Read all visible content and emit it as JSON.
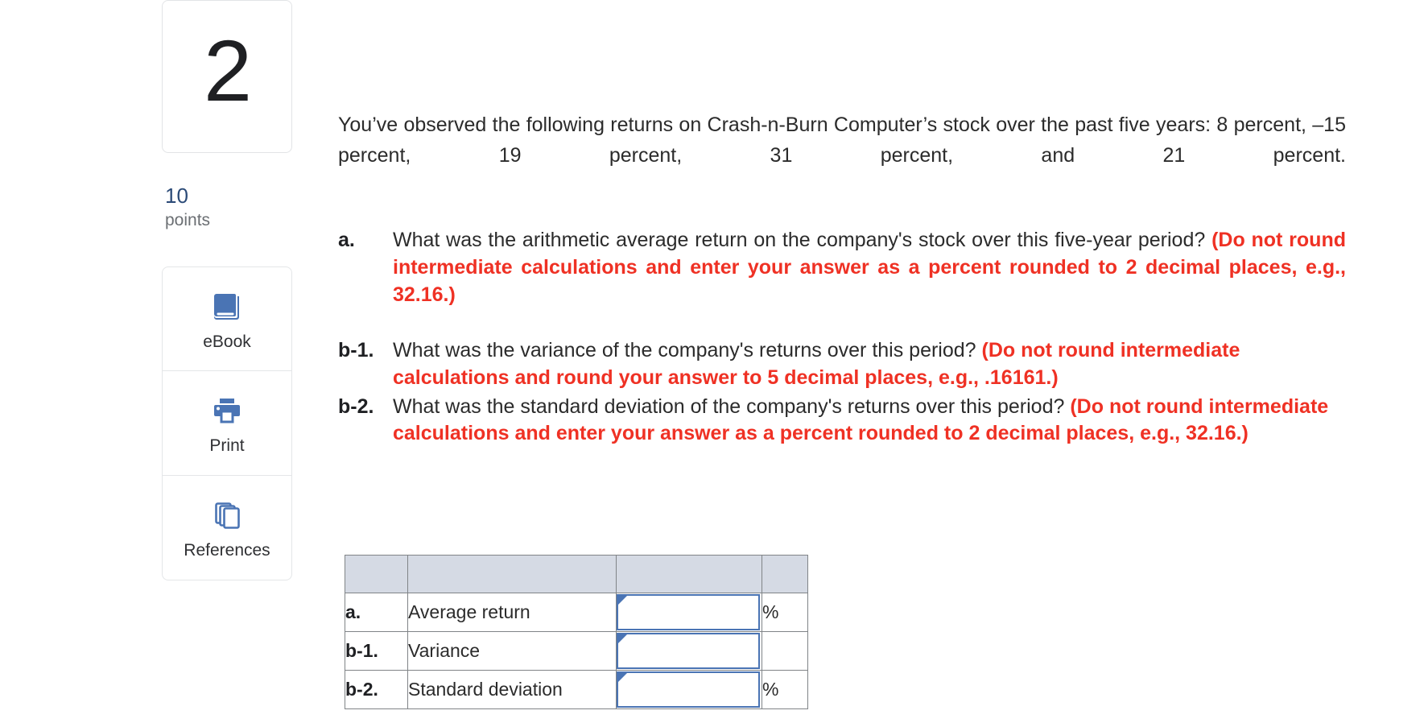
{
  "question": {
    "number": "2",
    "points_value": "10",
    "points_label": "points",
    "intro": "You’ve observed the following returns on Crash-n-Burn Computer’s stock over the past five years: 8 percent, –15 percent, 19 percent, 31 percent, and 21 percent."
  },
  "tools": [
    {
      "label": "eBook",
      "icon": "book-icon"
    },
    {
      "label": "Print",
      "icon": "printer-icon"
    },
    {
      "label": "References",
      "icon": "pages-stack-icon"
    }
  ],
  "parts": [
    {
      "letter": "a.",
      "text": "What was the arithmetic average return on the company's stock over this five-year period? ",
      "hint": "(Do not round intermediate calculations and enter your answer as a percent rounded to 2 decimal places, e.g., 32.16.)"
    },
    {
      "letter": "b-1.",
      "text": "What was the variance of the company's returns over this period? ",
      "hint": "(Do not round intermediate calculations and round your answer to 5 decimal places, e.g., .16161.)"
    },
    {
      "letter": "b-2.",
      "text": "What was the standard deviation of the company's returns over this period? ",
      "hint": "(Do not round intermediate calculations and enter your answer as a percent rounded to 2 decimal places, e.g., 32.16.)"
    }
  ],
  "answer_table": {
    "header": {
      "c1": "",
      "c2": "",
      "c3": "",
      "c4": ""
    },
    "rows": [
      {
        "label": "a.",
        "description": "Average return",
        "value": "",
        "unit": "%"
      },
      {
        "label": "b-1.",
        "description": "Variance",
        "value": "",
        "unit": ""
      },
      {
        "label": "b-2.",
        "description": "Standard deviation",
        "value": "",
        "unit": "%"
      }
    ]
  },
  "colors": {
    "hint_red": "#ef3124",
    "points_blue": "#2b4a77",
    "icon_blue": "#4a74b4",
    "table_header_fill": "#d5dae4",
    "table_border": "#808487"
  }
}
